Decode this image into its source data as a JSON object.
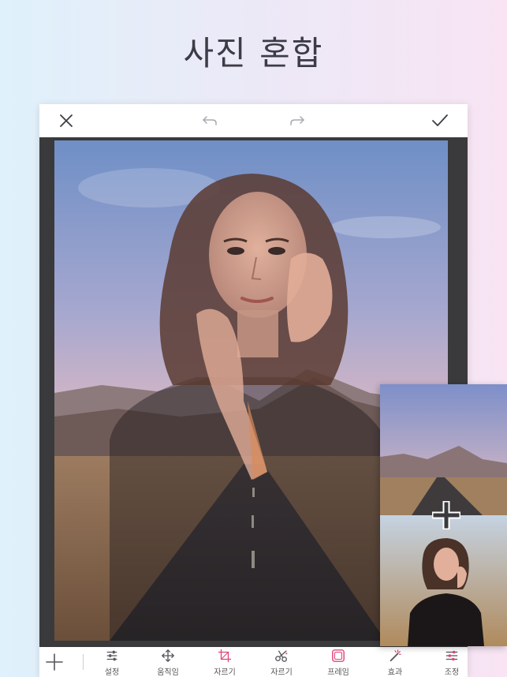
{
  "headline": "사진 혼합",
  "topbar": {
    "close_icon": "close-icon",
    "undo_icon": "undo-icon",
    "redo_icon": "redo-icon",
    "confirm_icon": "checkmark-icon"
  },
  "toolbar": {
    "add_icon": "plus-icon",
    "tools": [
      {
        "id": "settings",
        "label": "설정",
        "icon": "sliders-icon"
      },
      {
        "id": "move",
        "label": "움직임",
        "icon": "move-arrows-icon"
      },
      {
        "id": "crop",
        "label": "자르기",
        "icon": "crop-icon"
      },
      {
        "id": "cut",
        "label": "자르기",
        "icon": "scissors-icon"
      },
      {
        "id": "frame",
        "label": "프레임",
        "icon": "frame-icon"
      },
      {
        "id": "effect",
        "label": "효과",
        "icon": "magic-wand-icon"
      },
      {
        "id": "adjust",
        "label": "조정",
        "icon": "adjust-sliders-icon"
      }
    ]
  },
  "colors": {
    "accent": "#e0457b",
    "icon_gray": "#6a6a72",
    "canvas_bg": "#3a3a3c"
  }
}
